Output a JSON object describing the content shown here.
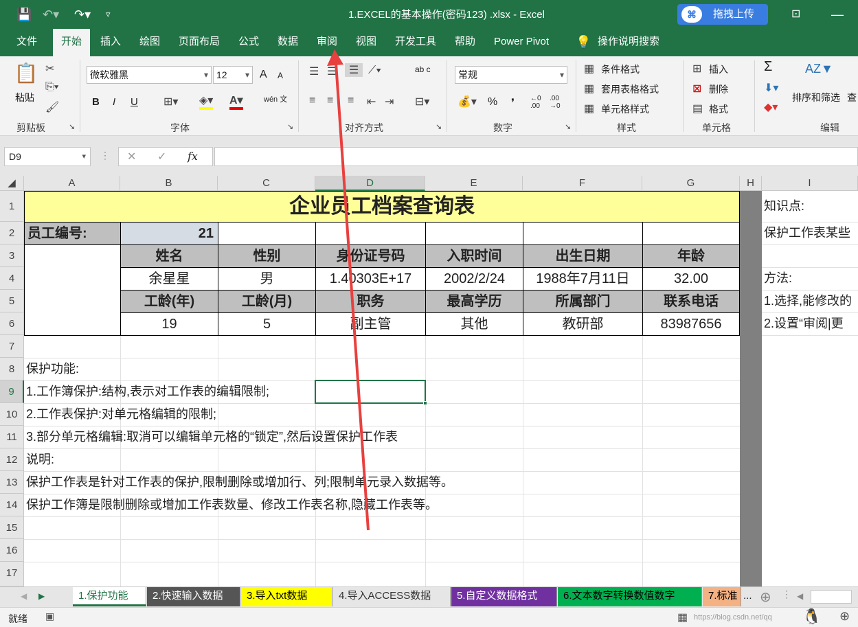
{
  "window": {
    "title": "1.EXCEL的基本操作(密码123)  .xlsx  -  Excel",
    "upload_label": "拖拽上传",
    "cloud_logo_text": "⌘"
  },
  "menu": {
    "items": [
      "文件",
      "开始",
      "插入",
      "绘图",
      "页面布局",
      "公式",
      "数据",
      "审阅",
      "视图",
      "开发工具",
      "帮助",
      "Power Pivot",
      "操作说明搜索"
    ],
    "active": "开始"
  },
  "ribbon": {
    "paste": "粘贴",
    "clipboard": "剪贴板",
    "font_name": "微软雅黑",
    "font_size": "12",
    "grow_font": "A",
    "shrink_font": "A",
    "bold": "B",
    "italic": "I",
    "underline": "U",
    "phonetic": "wén 文",
    "font_group": "字体",
    "align_group": "对齐方式",
    "wrap": "ab c",
    "number_format": "常规",
    "number_group": "数字",
    "percent": "%",
    "comma": "❜",
    "inc_dec": "←0 .00",
    "dec_dec": ".00 →0",
    "cond_format": "条件格式",
    "table_format": "套用表格格式",
    "cell_style": "单元格样式",
    "style_group": "样式",
    "insert": "插入",
    "delete": "删除",
    "format": "格式",
    "cells_group": "单元格",
    "sum": "Σ",
    "sort_filter": "排序和筛选",
    "find": "查",
    "edit_group": "编辑"
  },
  "formula_bar": {
    "name_box": "D9",
    "fx": "fx",
    "content": ""
  },
  "grid": {
    "columns": [
      "A",
      "B",
      "C",
      "D",
      "E",
      "F",
      "G",
      "H",
      "I"
    ],
    "selected_column": "D",
    "rows": [
      "1",
      "2",
      "3",
      "4",
      "5",
      "6",
      "7",
      "8",
      "9",
      "10",
      "11",
      "12",
      "13",
      "14",
      "15",
      "16",
      "17"
    ],
    "selected_row": "9",
    "selected_cell": "D9"
  },
  "sheet": {
    "title": "企业员工档案查询表",
    "emp_id_label": "员工编号:",
    "emp_id": "21",
    "row3_headers": [
      "姓名",
      "性别",
      "身份证号码",
      "入职时间",
      "出生日期",
      "年龄"
    ],
    "row4_values": [
      "余星星",
      "男",
      "1.40303E+17",
      "2002/2/24",
      "1988年7月11日",
      "32.00"
    ],
    "row5_headers": [
      "工龄(年)",
      "工龄(月)",
      "职务",
      "最高学历",
      "所属部门",
      "联系电话"
    ],
    "row6_values": [
      "19",
      "5",
      "副主管",
      "其他",
      "教研部",
      "83987656"
    ],
    "notes": [
      "保护功能:",
      "1.工作簿保护:结构,表示对工作表的编辑限制;",
      "2.工作表保护:对单元格编辑的限制;",
      "3.部分单元格编辑:取消可以编辑单元格的“锁定”,然后设置保护工作表",
      "说明:",
      "保护工作表是针对工作表的保护,限制删除或增加行、列;限制单元录入数据等。",
      "保护工作簿是限制删除或增加工作表数量、修改工作表名称,隐藏工作表等。"
    ],
    "side": {
      "knowledge": "知识点:",
      "protect": "保护工作表某些",
      "method": "方法:",
      "step1": "1.选择,能修改的",
      "step2": "2.设置“审阅|更"
    }
  },
  "tabs": [
    {
      "label": "1.保护功能",
      "bg": "#ffffff",
      "color": "#217346"
    },
    {
      "label": "2.快速输入数据",
      "bg": "#555555",
      "color": "#ffffff"
    },
    {
      "label": "3.导入txt数据",
      "bg": "#ffff00",
      "color": "#000000"
    },
    {
      "label": "4.导入ACCESS数据",
      "bg": "#e6e6e6",
      "color": "#333333"
    },
    {
      "label": "5.自定义数据格式",
      "bg": "#7030a0",
      "color": "#ffffff"
    },
    {
      "label": "6.文本数字转换数值数字",
      "bg": "#00b050",
      "color": "#000000"
    },
    {
      "label": "7.标准",
      "bg": "#f4b183",
      "color": "#000000"
    }
  ],
  "tabs_more": "...",
  "status": {
    "ready": "就绪",
    "watermark": "https://blog.csdn.net/qq"
  },
  "colors": {
    "excel_green": "#217346",
    "title_fill": "#ffff99",
    "header_fill": "#bfbfbf",
    "id_fill": "#d6dce4",
    "arrow_red": "#e8403f"
  }
}
